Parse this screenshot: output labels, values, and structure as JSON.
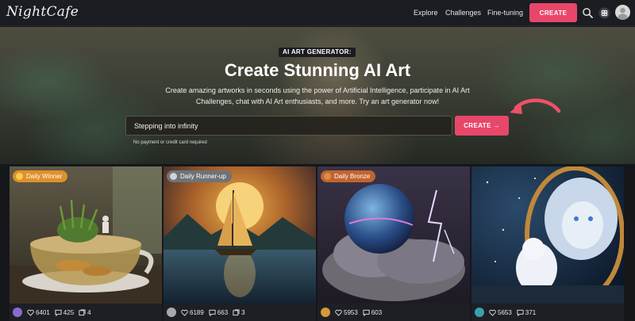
{
  "nav": {
    "logo": "NightCafe",
    "links": [
      "Explore",
      "Challenges",
      "Fine-tuning"
    ],
    "create_label": "CREATE",
    "icons": [
      "search-icon",
      "dice-icon",
      "user-avatar"
    ]
  },
  "hero": {
    "badge": "AI ART GENERATOR:",
    "title": "Create Stunning AI Art",
    "subtitle": "Create amazing artworks in seconds using the power of Artificial Intelligence, participate in AI Art Challenges, chat with AI Art enthusiasts, and more. Try an art generator now!",
    "prompt_value": "Stepping into infinity",
    "create_label": "CREATE →",
    "hint": "No payment or credit card required"
  },
  "colors": {
    "accent": "#e8476a",
    "winner": "#e0902c",
    "runner_up": "#9aa0a8",
    "bronze": "#c76a33"
  },
  "gallery": [
    {
      "tag": "Daily Winner",
      "likes": "6401",
      "comments": "425",
      "images": "4",
      "tag_color": "#e0902c"
    },
    {
      "tag": "Daily Runner-up",
      "likes": "6189",
      "comments": "663",
      "images": "3",
      "tag_color": "#6f7378"
    },
    {
      "tag": "Daily Bronze",
      "likes": "5953",
      "comments": "603",
      "images": "",
      "tag_color": "#c2642f"
    },
    {
      "tag": "",
      "likes": "5653",
      "comments": "371",
      "images": "",
      "tag_color": ""
    }
  ]
}
